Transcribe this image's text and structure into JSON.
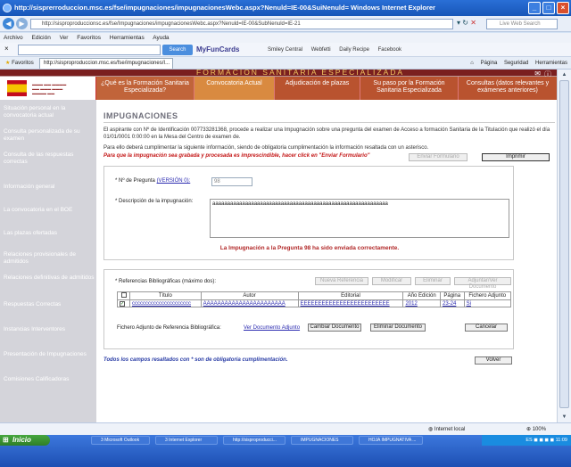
{
  "window": {
    "title": "http://sisprerroduccion.msc.es/fse/impugnaciones/impugnacionesWebc.aspx?Nenuld=IE-00&SuiNenuld=  Windows Internet Explorer"
  },
  "address": {
    "url": "http://sisproproduccionsc.es/fse/Impugnaciones/impugnacionesWebc.aspx?Nenuld=IE-00&SubNenuld=IE-21",
    "live_search": "Live Web Search"
  },
  "menu": [
    "Archivo",
    "Edición",
    "Ver",
    "Favoritos",
    "Herramientas",
    "Ayuda"
  ],
  "toolbar": {
    "search_button": "Search",
    "brand": "MyFunCards",
    "items": [
      "Smiley Central",
      "Webfetti",
      "Daily Recipe",
      "Facebook"
    ]
  },
  "favorites": {
    "label": "Favoritos",
    "tab_title": "http://sisproproduccion.msc.es/fse/impugnaciones/I...",
    "commands": [
      "Página",
      "Seguridad",
      "Herramientas"
    ]
  },
  "banner": {
    "title": "FORMACIÓN SANITARIA ESPECIALIZADA"
  },
  "nav_tabs": [
    "¿Qué es la Formación Sanitaria Especializada?",
    "Convocatoria Actual",
    "Adjudicación de plazas",
    "Su paso por la Formación Sanitaria Especializada",
    "Consultas (datos relevantes y exámenes anteriores)"
  ],
  "sidebar": [
    "Situación personal en la convocatoria actual",
    "Consulta personalizada de su examen",
    "Consulta de las respuestas correctas",
    "Información general",
    "La convocatoria en el BOE",
    "Las plazas ofertadas",
    "Relaciones provisionales de admitidos",
    "Relaciones definitivas de admitidos",
    "Respuestas Correctas",
    "Instancias Interventores",
    "Presentación de Impugnaciones",
    "Comisiones Calificadoras"
  ],
  "page": {
    "title": "IMPUGNACIONES",
    "intro": "El aspirante con Nº de Identificación 007733281368, procede a realizar una Impugnación sobre una pregunta del examen de Acceso a formación Sanitaria de la Titulación que realizó el día 01/01/0001 0:00:00 en la Mesa del Centro de examen de.",
    "instructions": "Para ello deberá cumplimentar la siguiente información, siendo de obligatoria cumplimentación la información resaltada con un asterisco.",
    "warning": "Para que la impugnación sea grabada y procesada es imprescindible, hacer click en \"Enviar Formulario\"",
    "send_button": "Enviar Formulario",
    "print_button": "Imprimir",
    "question_label": "* Nº de Pregunta",
    "question_link": "(VERSIÓN 0):",
    "question_value": "98",
    "description_label": "* Descripción de la impugnación:",
    "description_value": "aaaaaaaaaaaaaaaaaaaaaaaaaaaaaaaaaaaaaaaaaaaaaaaaaaaaaaaaaaa",
    "success": "La Impugnación a la Pregunta 98 ha sido enviada correctamente.",
    "refs_label": "* Referencias Bibliográficas (máximo dos):",
    "ref_buttons": [
      "Nueva Referencia",
      "Modificar",
      "Eliminar",
      "Adjuntar/Ver Documento"
    ],
    "table_headers": [
      "",
      "Título",
      "Autor",
      "Editorial",
      "Año Edición",
      "Página",
      "Fichero Adjunto"
    ],
    "table_row": [
      "",
      "cccccccccccccccccccccc",
      "AAAAAAAAAAAAAAAAAAAAAAA",
      "EEEEEEEEEEEEEEEEEEEEEEEEE",
      "2012",
      "23-24",
      "Si"
    ],
    "attach_label": "Fichero Adjunto de Referencia Bibliográfica:",
    "view_doc": "Ver Documento Adjunto",
    "change_doc": "Cambiar Documento",
    "delete_doc": "Eliminar Documento",
    "cancel": "Cancelar",
    "footer_note": "Todos los campos resaltados con * son de obligatoria cumplimentación.",
    "back": "Volver"
  },
  "status": {
    "zone": "Internet local",
    "zoom": "100%"
  },
  "taskbar": {
    "start": "Inicio",
    "tasks": [
      "3 Microsoft Outlook",
      "3 Internet Explorer",
      "http://sisproproducci...",
      "IMPUGNACIONES",
      "HOJA IMPUGNATIVA ..."
    ],
    "clock": "11:09",
    "lang": "ES"
  },
  "colors": {
    "banner": "#7a1f1f",
    "nav": "#b9532f",
    "nav_active": "#d98a40",
    "sidebar": "#d4d4da",
    "accent_red": "#c31515"
  }
}
